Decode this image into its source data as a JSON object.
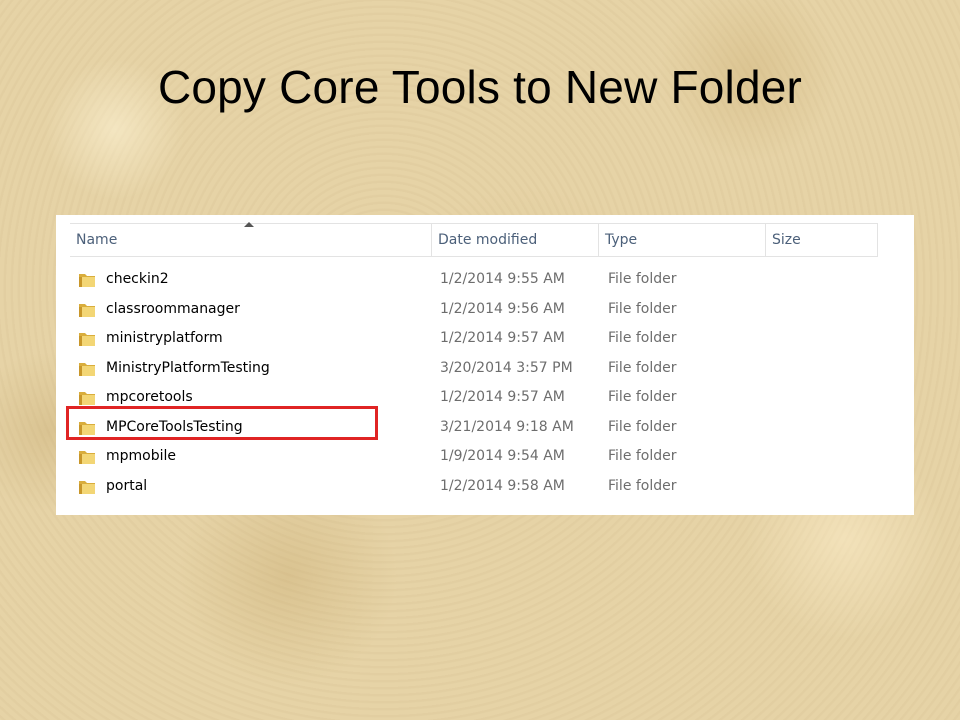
{
  "slide": {
    "title": "Copy Core Tools to New Folder"
  },
  "explorer": {
    "columns": {
      "name": "Name",
      "date_modified": "Date modified",
      "type": "Type",
      "size": "Size"
    },
    "sort": {
      "column": "Name",
      "direction": "ascending"
    },
    "rows": [
      {
        "name": "checkin2",
        "date": "1/2/2014 9:55 AM",
        "type": "File folder"
      },
      {
        "name": "classroommanager",
        "date": "1/2/2014 9:56 AM",
        "type": "File folder"
      },
      {
        "name": "ministryplatform",
        "date": "1/2/2014 9:57 AM",
        "type": "File folder"
      },
      {
        "name": "MinistryPlatformTesting",
        "date": "3/20/2014 3:57 PM",
        "type": "File folder"
      },
      {
        "name": "mpcoretools",
        "date": "1/2/2014 9:57 AM",
        "type": "File folder"
      },
      {
        "name": "MPCoreToolsTesting",
        "date": "3/21/2014 9:18 AM",
        "type": "File folder",
        "highlighted": true
      },
      {
        "name": "mpmobile",
        "date": "1/9/2014 9:54 AM",
        "type": "File folder"
      },
      {
        "name": "portal",
        "date": "1/2/2014 9:58 AM",
        "type": "File folder"
      }
    ]
  },
  "icons": {
    "folder": "folder-icon",
    "sort": "sort-ascending-icon"
  },
  "colors": {
    "highlight": "#e02424",
    "header_text": "#4c607a",
    "folder": "#e8c45a"
  }
}
